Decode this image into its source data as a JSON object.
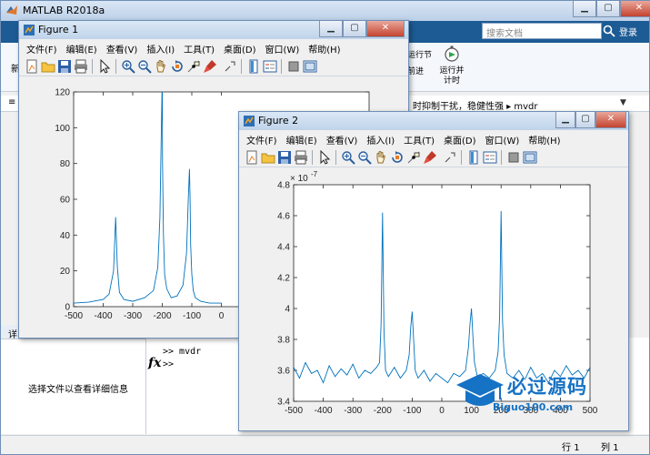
{
  "matlab": {
    "title": "MATLAB R2018a",
    "search_placeholder": "搜索文档",
    "login_label": "登录",
    "ribbon_run_section": "运行节",
    "ribbon_run_time": "运行并\n计时",
    "ribbon_advance": "前进",
    "path_text": "时抑制干扰，稳健性强 ▸ mvdr",
    "detail_header": "详",
    "detail_message": "选择文件以查看详细信息",
    "command_lines": [
      ">> mvdr",
      ">>"
    ],
    "status_row_label": "行",
    "status_row_value": "1",
    "status_col_label": "列",
    "status_col_value": "1",
    "side_labels": [
      "新",
      "≡"
    ]
  },
  "figure1": {
    "title": "Figure 1",
    "menu": [
      "文件(F)",
      "编辑(E)",
      "查看(V)",
      "插入(I)",
      "工具(T)",
      "桌面(D)",
      "窗口(W)",
      "帮助(H)"
    ],
    "toolbar_icons": [
      "new-figure-icon",
      "open-icon",
      "save-icon",
      "print-icon",
      "pointer-icon",
      "zoom-in-icon",
      "zoom-out-icon",
      "pan-icon",
      "rotate-icon",
      "data-cursor-icon",
      "brush-icon",
      "link-icon",
      "colorbar-icon",
      "legend-icon",
      "hide-tools-icon",
      "show-tools-icon"
    ],
    "y_ticks": [
      "0",
      "20",
      "40",
      "60",
      "80",
      "100",
      "120"
    ],
    "x_ticks": [
      "-500",
      "-400",
      "-300",
      "-200",
      "-100",
      "0"
    ]
  },
  "figure2": {
    "title": "Figure 2",
    "menu": [
      "文件(F)",
      "编辑(E)",
      "查看(V)",
      "插入(I)",
      "工具(T)",
      "桌面(D)",
      "窗口(W)",
      "帮助(H)"
    ],
    "toolbar_icons": [
      "new-figure-icon",
      "open-icon",
      "save-icon",
      "print-icon",
      "pointer-icon",
      "zoom-in-icon",
      "zoom-out-icon",
      "pan-icon",
      "rotate-icon",
      "data-cursor-icon",
      "brush-icon",
      "link-icon",
      "colorbar-icon",
      "legend-icon",
      "hide-tools-icon",
      "show-tools-icon"
    ],
    "y_exponent": "× 10",
    "y_exponent_power": "-7",
    "y_ticks": [
      "3.4",
      "3.6",
      "3.8",
      "4",
      "4.2",
      "4.4",
      "4.6",
      "4.8"
    ],
    "x_ticks": [
      "-500",
      "-400",
      "-300",
      "-200",
      "-100",
      "0",
      "100",
      "200",
      "300",
      "400",
      "500"
    ]
  },
  "watermark": {
    "cn": "必过源码",
    "en": "Biguo100.com"
  },
  "chart_data": [
    {
      "type": "line",
      "title": "",
      "xlabel": "",
      "ylabel": "",
      "xlim": [
        -500,
        500
      ],
      "ylim": [
        0,
        120
      ],
      "grid": false,
      "series": [
        {
          "x": [
            -500,
            -450,
            -400,
            -380,
            -365,
            -358,
            -352,
            -345,
            -330,
            -300,
            -260,
            -230,
            -215,
            -208,
            -204,
            -201,
            -200,
            -199,
            -196,
            -192,
            -185,
            -170,
            -150,
            -130,
            -118,
            -112,
            -108,
            -106,
            -104,
            -100,
            -95,
            -88,
            -70,
            -40,
            0
          ],
          "y": [
            2,
            2.5,
            4,
            7,
            20,
            50,
            22,
            8,
            4,
            3,
            5,
            9,
            22,
            50,
            90,
            120,
            120,
            80,
            40,
            18,
            10,
            5,
            6,
            12,
            30,
            60,
            77,
            60,
            35,
            18,
            9,
            5,
            3,
            2,
            2
          ]
        }
      ]
    },
    {
      "type": "line",
      "title": "",
      "xlabel": "",
      "ylabel": "",
      "y_scale_exponent": -7,
      "xlim": [
        -500,
        500
      ],
      "ylim": [
        3.4,
        4.8
      ],
      "grid": false,
      "series": [
        {
          "x": [
            -500,
            -480,
            -460,
            -440,
            -420,
            -400,
            -380,
            -360,
            -340,
            -320,
            -300,
            -280,
            -260,
            -240,
            -220,
            -210,
            -205,
            -200,
            -195,
            -190,
            -180,
            -160,
            -140,
            -120,
            -110,
            -105,
            -100,
            -95,
            -90,
            -80,
            -60,
            -40,
            -20,
            0,
            20,
            40,
            60,
            80,
            90,
            95,
            100,
            105,
            110,
            120,
            140,
            160,
            180,
            190,
            195,
            200,
            205,
            210,
            220,
            240,
            260,
            280,
            300,
            320,
            340,
            360,
            380,
            400,
            420,
            440,
            460,
            480,
            500
          ],
          "y": [
            3.62,
            3.55,
            3.65,
            3.58,
            3.6,
            3.52,
            3.63,
            3.56,
            3.61,
            3.57,
            3.64,
            3.55,
            3.6,
            3.58,
            3.62,
            3.65,
            3.9,
            4.62,
            3.85,
            3.6,
            3.56,
            3.62,
            3.55,
            3.6,
            3.7,
            3.88,
            3.98,
            3.8,
            3.6,
            3.55,
            3.6,
            3.53,
            3.58,
            3.55,
            3.52,
            3.58,
            3.56,
            3.6,
            3.75,
            3.9,
            4.0,
            3.82,
            3.65,
            3.56,
            3.58,
            3.55,
            3.6,
            3.72,
            3.95,
            4.63,
            3.92,
            3.7,
            3.58,
            3.55,
            3.6,
            3.54,
            3.62,
            3.55,
            3.58,
            3.52,
            3.6,
            3.56,
            3.63,
            3.57,
            3.6,
            3.55,
            3.62
          ]
        }
      ]
    }
  ]
}
